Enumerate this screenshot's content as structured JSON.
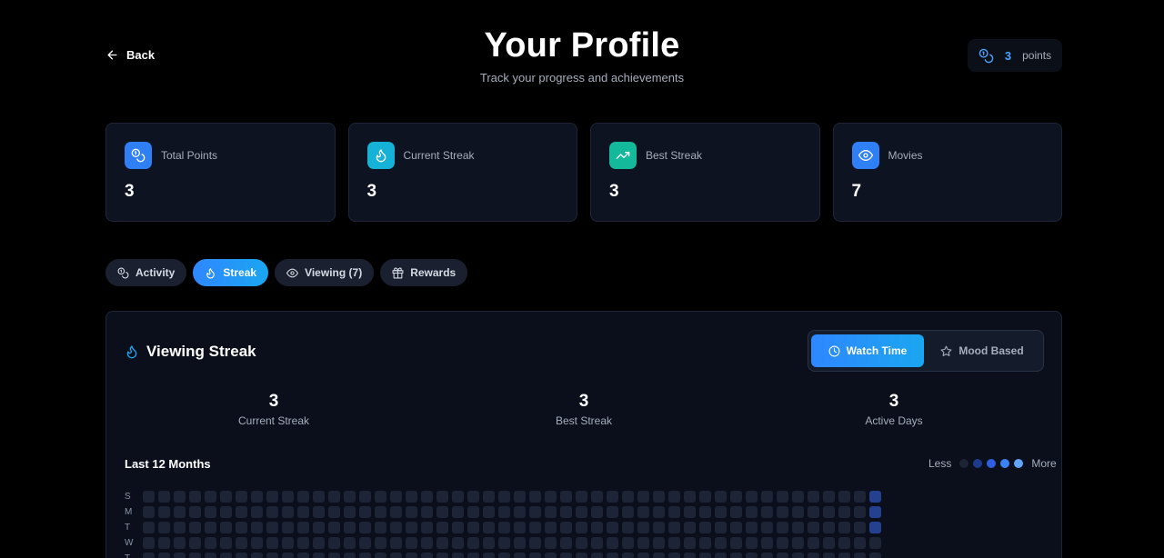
{
  "header": {
    "back_label": "Back",
    "title": "Your Profile",
    "subtitle": "Track your progress and achievements",
    "points_value": "3",
    "points_label": "points"
  },
  "stats": [
    {
      "label": "Total Points",
      "value": "3",
      "icon": "coins-icon",
      "color": "#2f7ff5"
    },
    {
      "label": "Current Streak",
      "value": "3",
      "icon": "flame-icon",
      "color": "#16b1d6"
    },
    {
      "label": "Best Streak",
      "value": "3",
      "icon": "trending-up-icon",
      "color": "#14b89a"
    },
    {
      "label": "Movies",
      "value": "7",
      "icon": "eye-icon",
      "color": "#2f7ff5"
    }
  ],
  "tabs": [
    {
      "label": "Activity",
      "icon": "coins-icon",
      "active": false
    },
    {
      "label": "Streak",
      "icon": "flame-icon",
      "active": true
    },
    {
      "label": "Viewing (7)",
      "icon": "eye-icon",
      "active": false
    },
    {
      "label": "Rewards",
      "icon": "gift-icon",
      "active": false
    }
  ],
  "streak_panel": {
    "title": "Viewing Streak",
    "toggle": {
      "watch_time": "Watch Time",
      "mood_based": "Mood Based",
      "selected": "Watch Time"
    },
    "summary": [
      {
        "value": "3",
        "label": "Current Streak"
      },
      {
        "value": "3",
        "label": "Best Streak"
      },
      {
        "value": "3",
        "label": "Active Days"
      }
    ],
    "heatmap_title": "Last 12 Months",
    "legend_less": "Less",
    "legend_more": "More",
    "legend_colors": [
      "#1c2435",
      "#1e3a8a",
      "#2f5fe0",
      "#3b82f6",
      "#60a5fa"
    ],
    "day_labels": [
      "S",
      "M",
      "T",
      "W",
      "T"
    ],
    "weeks": 48,
    "active_cells": [
      {
        "row": 0,
        "col": 47,
        "level": 1
      },
      {
        "row": 1,
        "col": 47,
        "level": 1
      },
      {
        "row": 2,
        "col": 47,
        "level": 1
      }
    ]
  },
  "colors": {
    "accent": "#2f87ff",
    "accent_cyan": "#1aa6f0",
    "card_bg": "#0d1321",
    "page_bg": "#000000"
  }
}
